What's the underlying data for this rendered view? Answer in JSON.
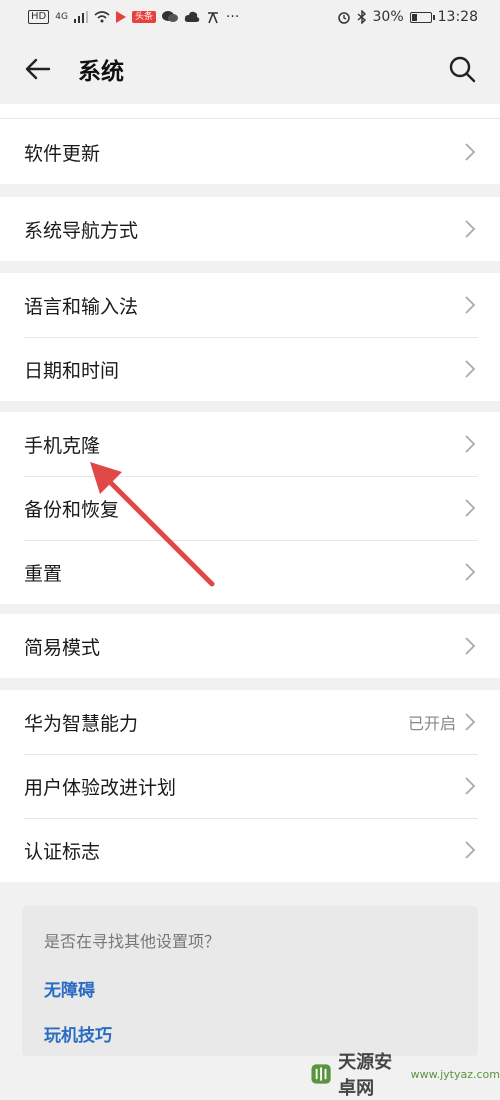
{
  "status_bar": {
    "network_label": "HD",
    "signal_label": "4G",
    "red_badge": "头条",
    "overflow": "···",
    "battery_text": "30%",
    "battery_level": 0.3,
    "time": "13:28"
  },
  "header": {
    "title": "系统"
  },
  "sections": [
    {
      "items": [
        {
          "label": "软件更新"
        }
      ]
    },
    {
      "items": [
        {
          "label": "系统导航方式"
        }
      ]
    },
    {
      "items": [
        {
          "label": "语言和输入法"
        },
        {
          "label": "日期和时间"
        }
      ]
    },
    {
      "items": [
        {
          "label": "手机克隆"
        },
        {
          "label": "备份和恢复"
        },
        {
          "label": "重置"
        }
      ]
    },
    {
      "items": [
        {
          "label": "简易模式"
        }
      ]
    },
    {
      "items": [
        {
          "label": "华为智慧能力",
          "value": "已开启"
        },
        {
          "label": "用户体验改进计划"
        },
        {
          "label": "认证标志"
        }
      ]
    }
  ],
  "suggestions": {
    "question": "是否在寻找其他设置项？",
    "links": [
      "无障碍",
      "玩机技巧"
    ]
  },
  "watermark": {
    "name": "天源安卓网",
    "url": "www.jytyaz.com"
  },
  "colors": {
    "background": "#f1f1f1",
    "card": "#ffffff",
    "link": "#2a6bc4",
    "arrow": "#e04848"
  }
}
